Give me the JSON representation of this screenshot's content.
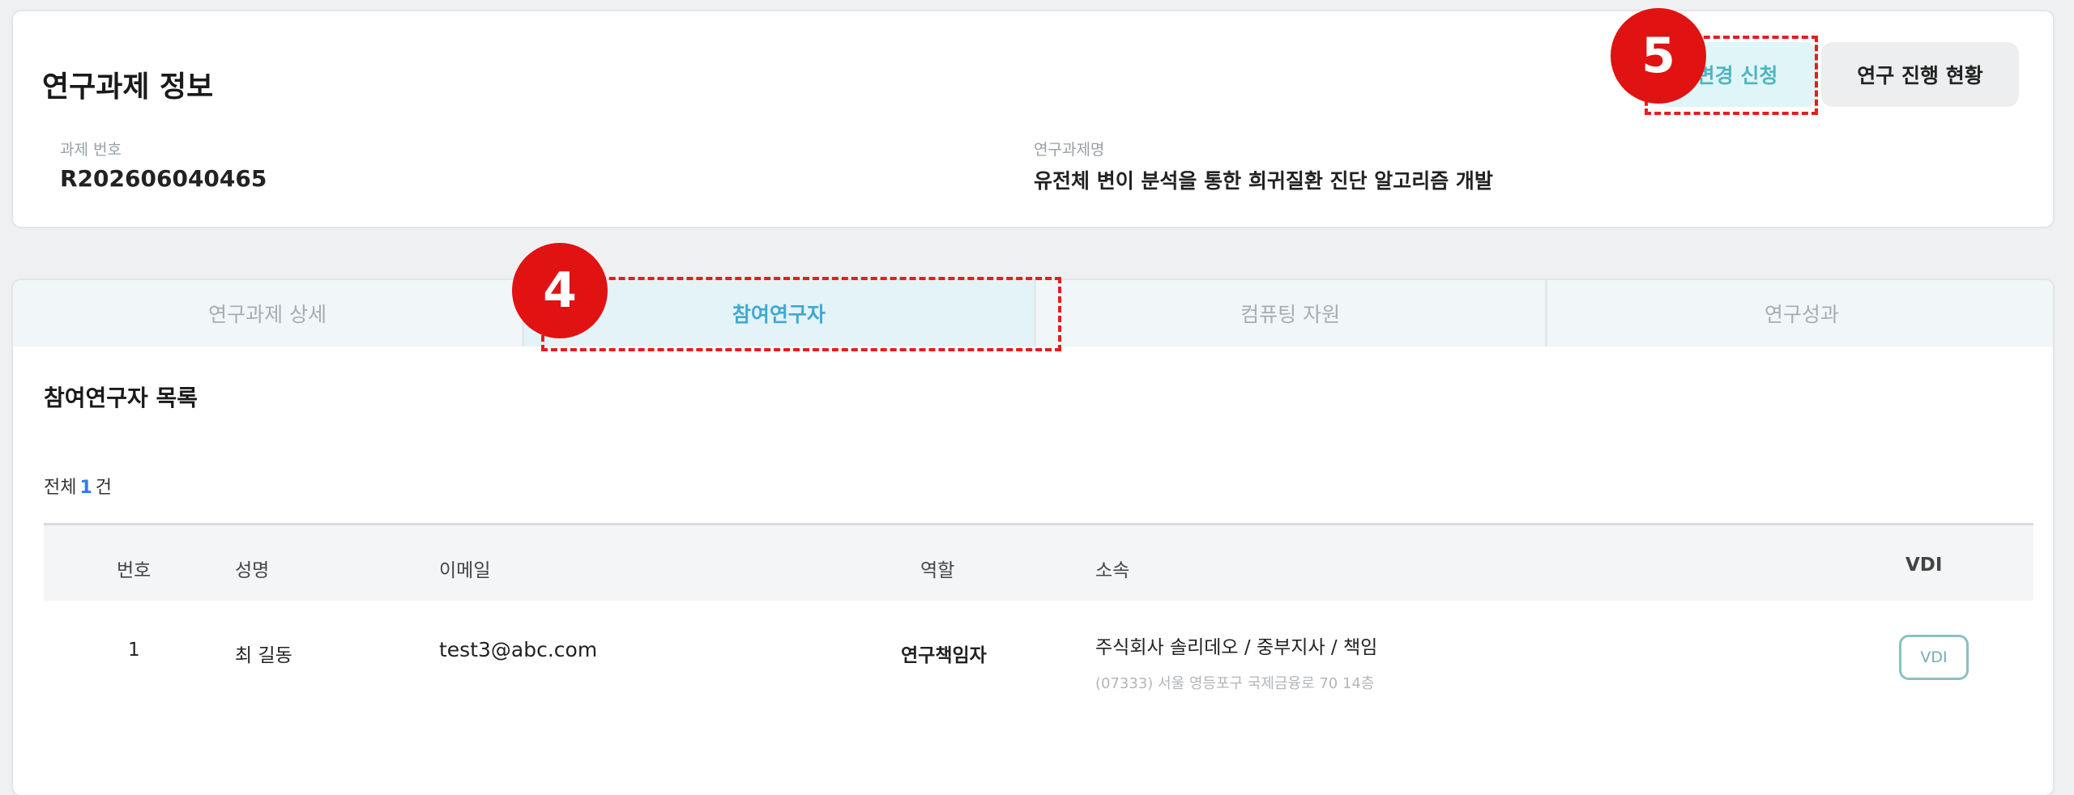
{
  "project_info": {
    "title": "연구과제 정보",
    "project_number_label": "과제 번호",
    "project_number": "R202606040465",
    "project_name_label": "연구과제명",
    "project_name": "유전체 변이 분석을 통한 희귀질환 진단 알고리즘 개발",
    "change_request_button": "변경 신청",
    "progress_status_button": "연구 진행 현황"
  },
  "annotations": {
    "badge_5": "5",
    "badge_4": "4"
  },
  "tabs": [
    {
      "label": "연구과제 상세",
      "active": false
    },
    {
      "label": "참여연구자",
      "active": true
    },
    {
      "label": "컴퓨팅 자원",
      "active": false
    },
    {
      "label": "연구성과",
      "active": false
    }
  ],
  "researchers": {
    "list_title": "참여연구자 목록",
    "total_prefix": "전체",
    "total_count": "1",
    "total_suffix": "건",
    "columns": {
      "number": "번호",
      "name": "성명",
      "email": "이메일",
      "role": "역할",
      "affiliation": "소속",
      "vdi": "VDI"
    },
    "rows": [
      {
        "number": "1",
        "name": "최 길동",
        "email": "test3@abc.com",
        "role": "연구책임자",
        "affiliation": "주식회사 솔리데오 / 중부지사 / 책임",
        "address": "(07333) 서울 영등포구 국제금융로 70 14층",
        "vdi_button": "VDI"
      }
    ]
  },
  "colors": {
    "accent": "#41a9d0",
    "annotation_red": "#e11212",
    "count_blue": "#2b7de9"
  }
}
